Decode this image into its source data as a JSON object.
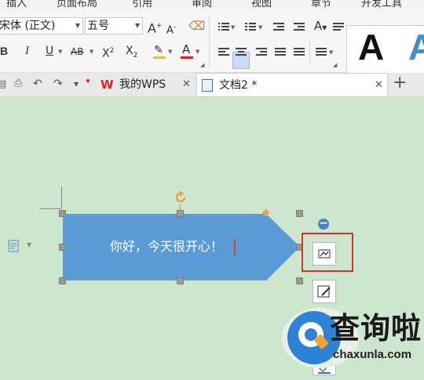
{
  "menu": {
    "items": [
      "插入",
      "页面布局",
      "引用",
      "审阅",
      "视图",
      "章节",
      "开发工具"
    ]
  },
  "toolbar": {
    "font_name": "宋体 (正文)",
    "font_size": "五号",
    "grow_font": "A",
    "shrink_font": "A",
    "bold": "B",
    "italic": "I",
    "underline": "U",
    "strike": "AB",
    "superscript": "X",
    "subscript": "X",
    "font_color": "A",
    "style_preview_1": "A",
    "style_preview_2": "A"
  },
  "tabs": {
    "wps_logo": "W",
    "wps_home": "我的WPS",
    "document": "文档2 *",
    "close": "✕",
    "new_tab": "+"
  },
  "shape": {
    "text": "你好，今天很开心！",
    "fill_color": "#5b9bd5"
  },
  "watermark": {
    "title": "查询啦",
    "url": "chaxunla.com"
  },
  "colors": {
    "canvas_bg": "#cde6ce",
    "accent_red": "#d8302b",
    "handle_orange": "#f2a04a"
  }
}
